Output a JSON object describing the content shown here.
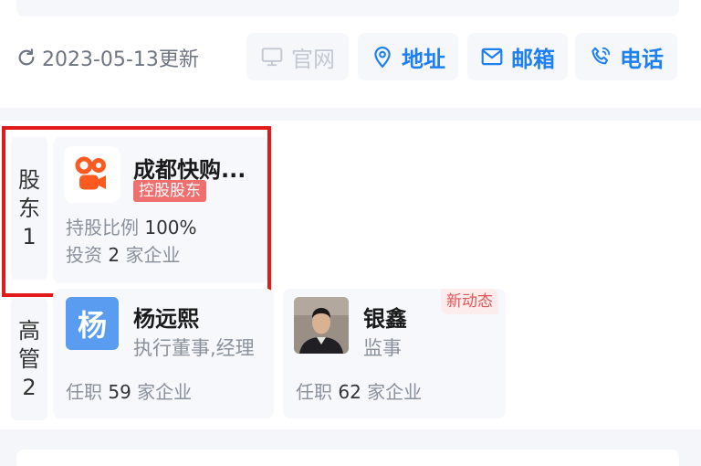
{
  "header": {
    "update_text": "2023-05-13更新",
    "actions": [
      {
        "label": "官网",
        "icon": "monitor-icon",
        "enabled": false
      },
      {
        "label": "地址",
        "icon": "location-pin-icon",
        "enabled": true
      },
      {
        "label": "邮箱",
        "icon": "mail-icon",
        "enabled": true
      },
      {
        "label": "电话",
        "icon": "phone-icon",
        "enabled": true
      }
    ]
  },
  "shareholders": {
    "label_chars": [
      "股",
      "东",
      "1"
    ],
    "items": [
      {
        "name": "成都快购...",
        "tag": "控股股东",
        "ratio_label": "持股比例",
        "ratio_value": "100%",
        "invest_prefix": "投资",
        "invest_count": "2",
        "invest_suffix": "家企业",
        "logo_icon": "kuaishou-logo-icon"
      }
    ]
  },
  "executives": {
    "label_chars": [
      "高",
      "管",
      "2"
    ],
    "items": [
      {
        "avatar_text": "杨",
        "name": "杨远熙",
        "role": "执行董事,经理",
        "job_prefix": "任职",
        "job_count": "59",
        "job_suffix": "家企业"
      },
      {
        "avatar_icon": "person-photo-icon",
        "name": "银鑫",
        "role": "监事",
        "badge": "新动态",
        "job_prefix": "任职",
        "job_count": "62",
        "job_suffix": "家企业"
      }
    ]
  },
  "colors": {
    "accent": "#1e7ff0",
    "tag_red": "#ef6f6f",
    "highlight_border": "#e11a1a",
    "kuaishou_orange": "#ff5a1f"
  }
}
